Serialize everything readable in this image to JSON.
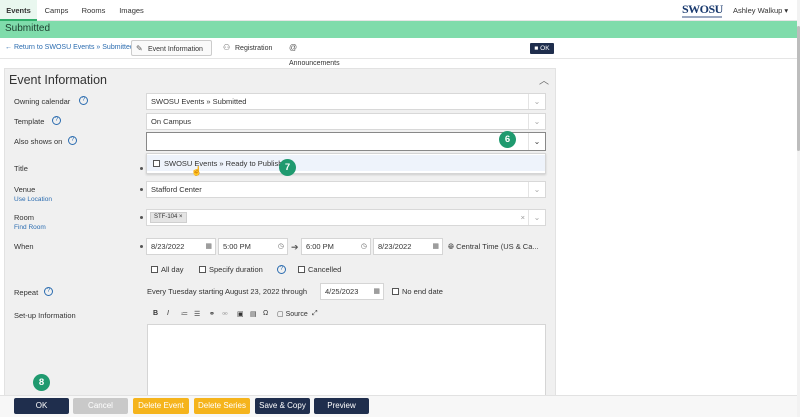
{
  "nav": {
    "tabs": [
      "Events",
      "Camps",
      "Rooms",
      "Images"
    ],
    "logo": "SWOSU",
    "user": "Ashley Walkup ▾"
  },
  "status": "Submitted",
  "subnav": {
    "return_link": "← Return to SWOSU Events » Submitted",
    "tabs": [
      "Event Information",
      "Registration",
      "Announcements"
    ],
    "ok": "OK"
  },
  "panel": {
    "title": "Event Information",
    "fields": {
      "owning_calendar": {
        "label": "Owning calendar",
        "value": "SWOSU Events » Submitted"
      },
      "template": {
        "label": "Template",
        "value": "On Campus"
      },
      "also_shows_on": {
        "label": "Also shows on",
        "value": ""
      },
      "dropdown_option": "SWOSU Events » Ready to Publish",
      "title": {
        "label": "Title"
      },
      "venue": {
        "label": "Venue",
        "link": "Use Location",
        "value": "Stafford Center"
      },
      "room": {
        "label": "Room",
        "link": "Find Room",
        "chip": "STF-104 ×"
      },
      "when": {
        "label": "When",
        "start_date": "8/23/2022",
        "start_time": "5:00 PM",
        "end_time": "6:00 PM",
        "end_date": "8/23/2022",
        "timezone": "Central Time (US & Ca..."
      },
      "options": {
        "all_day": "All day",
        "specify_duration": "Specify duration",
        "cancelled": "Cancelled"
      },
      "repeat": {
        "label": "Repeat",
        "text": "Every Tuesday starting August 23, 2022 through",
        "until": "4/25/2023",
        "no_end": "No end date"
      },
      "setup": {
        "label": "Set-up Information",
        "source": "Source"
      }
    }
  },
  "badges": {
    "b6": "6",
    "b7": "7",
    "b8": "8"
  },
  "buttons": {
    "ok": "OK",
    "cancel": "Cancel",
    "delete_event": "Delete Event",
    "delete_series": "Delete Series",
    "save_copy": "Save & Copy",
    "preview": "Preview"
  },
  "colors": {
    "status_bar": "#7fdcab",
    "badge": "#1f9a6f",
    "navy": "#1f2e4d",
    "amber": "#f5b41c"
  }
}
